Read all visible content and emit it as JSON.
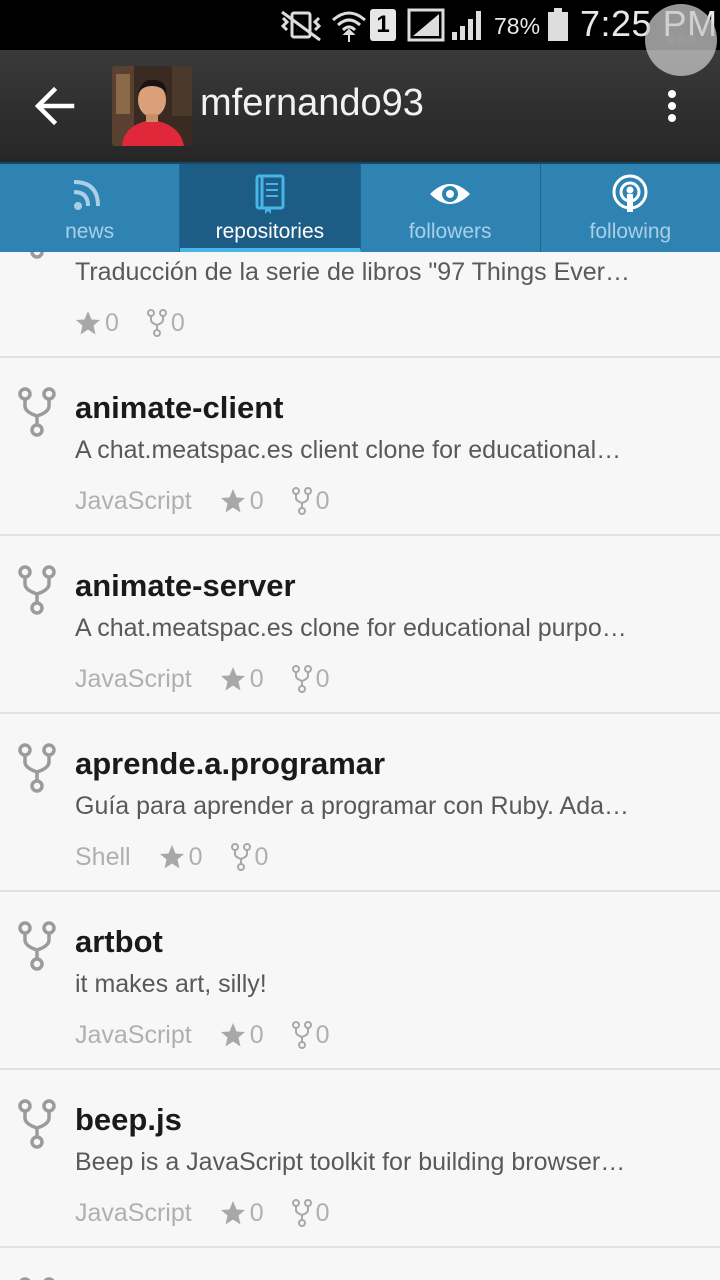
{
  "status_bar": {
    "battery_percent": "78%",
    "time": "7:25 PM",
    "sim_slot": "1",
    "icons": [
      "mute-vibrate-icon",
      "wifi-icon",
      "sim-1-icon",
      "signal-icon",
      "signal-icon",
      "battery-icon"
    ]
  },
  "header": {
    "username": "mfernando93",
    "icons": [
      "back-arrow-icon",
      "avatar",
      "overflow-menu-icon"
    ]
  },
  "tabs": [
    {
      "label": "news",
      "icon": "rss-icon",
      "active": false
    },
    {
      "label": "repositories",
      "icon": "book-icon",
      "active": true
    },
    {
      "label": "followers",
      "icon": "eye-icon",
      "active": false
    },
    {
      "label": "following",
      "icon": "broadcast-icon",
      "active": false
    }
  ],
  "repositories": [
    {
      "name": "",
      "description": "Traducción de la serie de libros \"97 Things Ever…",
      "language": "",
      "stars": "0",
      "forks": "0"
    },
    {
      "name": "animate-client",
      "description": "A chat.meatspac.es client clone for educational…",
      "language": "JavaScript",
      "stars": "0",
      "forks": "0"
    },
    {
      "name": "animate-server",
      "description": "A chat.meatspac.es clone for educational purpo…",
      "language": "JavaScript",
      "stars": "0",
      "forks": "0"
    },
    {
      "name": "aprende.a.programar",
      "description": "Guía para aprender a programar con Ruby. Ada…",
      "language": "Shell",
      "stars": "0",
      "forks": "0"
    },
    {
      "name": "artbot",
      "description": "it makes art, silly!",
      "language": "JavaScript",
      "stars": "0",
      "forks": "0"
    },
    {
      "name": "beep.js",
      "description": "Beep is a JavaScript toolkit for building browser…",
      "language": "JavaScript",
      "stars": "0",
      "forks": "0"
    }
  ],
  "colors": {
    "tab_bar": "#2f83b3",
    "tab_active": "#1d5c84",
    "tab_indicator": "#46b5e8",
    "action_bar": "#2e2e2e"
  }
}
